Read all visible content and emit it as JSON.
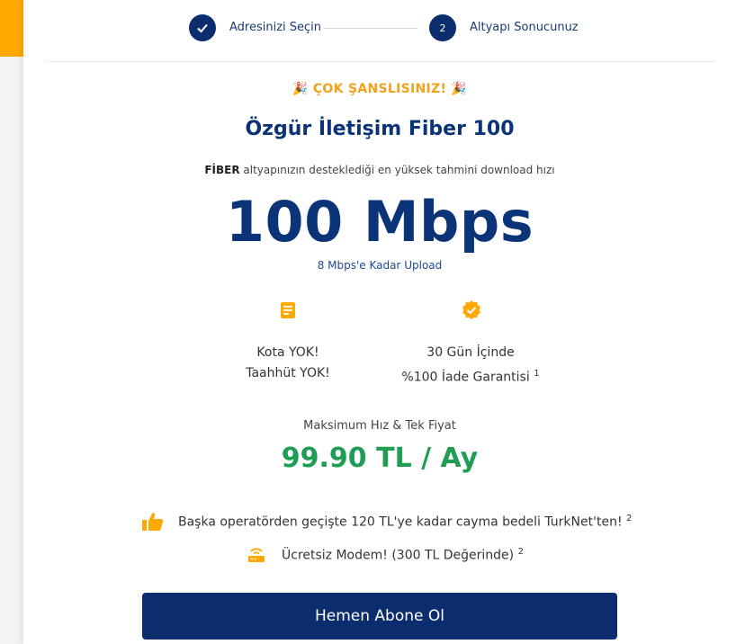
{
  "stepper": {
    "step1_label": "Adresinizi Seçin",
    "step2_number": "2",
    "step2_label": "Altyapı Sonucunuz"
  },
  "result": {
    "lucky_text": "ÇOK ŞANSLISINIZ!",
    "plan_name": "Özgür İletişim Fiber 100",
    "desc_bold": "FİBER",
    "desc_rest": " altyapınızın desteklediği en yüksek tahmini download hızı",
    "speed": "100 Mbps",
    "upload": "8 Mbps'e Kadar Upload"
  },
  "features": [
    {
      "icon": "document-icon",
      "line1": "Kota YOK!",
      "line2": "Taahhüt YOK!",
      "sup": ""
    },
    {
      "icon": "verified-badge-icon",
      "line1": "30 Gün İçinde",
      "line2": "%100 İade Garantisi",
      "sup": "1"
    }
  ],
  "pricing": {
    "label": "Maksimum Hız & Tek Fiyat",
    "price": "99.90 TL / Ay"
  },
  "perks": [
    {
      "icon": "thumbs-up-icon",
      "text": "Başka operatörden geçişte 120 TL'ye kadar cayma bedeli TurkNet'ten!",
      "sup": "2"
    },
    {
      "icon": "router-icon",
      "text": "Ücretsiz Modem! (300 TL Değerinde)",
      "sup": "2"
    }
  ],
  "cta": {
    "label": "Hemen Abone Ol"
  },
  "colors": {
    "primary": "#0b2d6e",
    "accent": "#f0a21b",
    "price": "#1f9d55"
  }
}
